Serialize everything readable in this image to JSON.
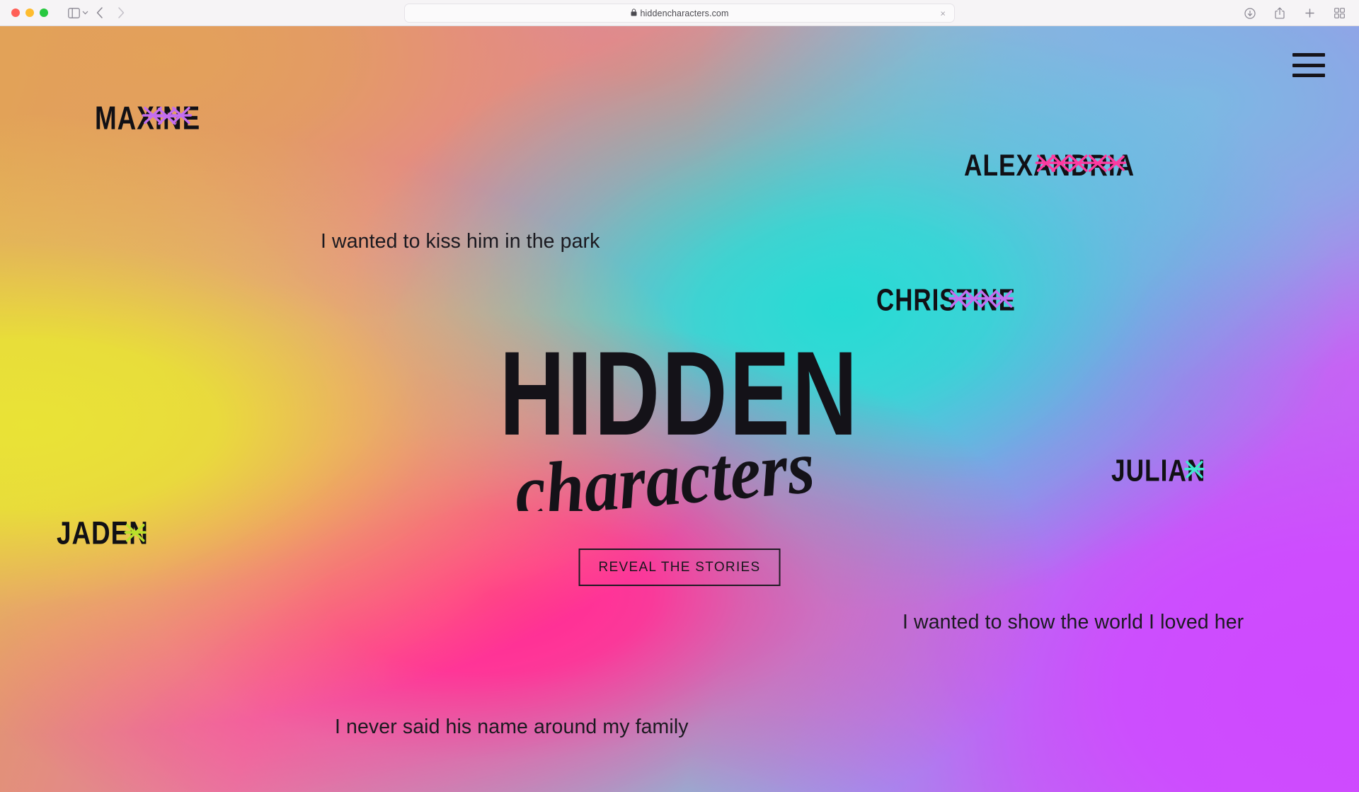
{
  "browser": {
    "url": "hiddencharacters.com",
    "secure_icon": "lock-icon",
    "clear_label": "×",
    "back_label": "‹",
    "forward_label": "›",
    "sidebar_label": "sidebar-icon",
    "tools": {
      "downloads": "downloads-icon",
      "share": "share-icon",
      "new_tab": "new-tab-icon",
      "tab_overview": "tab-overview-icon"
    }
  },
  "site": {
    "menu_label": "Menu",
    "logo": {
      "line1": "HIDDEN",
      "line2": "characters"
    },
    "cta": {
      "label": "REVEAL THE STORIES"
    },
    "names": [
      {
        "id": "maxine",
        "text": "MAXINE",
        "scribble_color": "#c46ef0",
        "scribble_count": 3
      },
      {
        "id": "alexandria",
        "text": "ALEXANDRIA",
        "scribble_color": "#ff3ba0",
        "scribble_count": 4
      },
      {
        "id": "christine",
        "text": "CHRISTINE",
        "scribble_color": "#c46ef0",
        "scribble_count": 4
      },
      {
        "id": "julian",
        "text": "JULIAN",
        "scribble_color": "#3fe8cf",
        "scribble_count": 1
      },
      {
        "id": "jaden",
        "text": "JADEN",
        "scribble_color": "#b8e02a",
        "scribble_count": 1
      }
    ],
    "quotes": [
      {
        "id": "park",
        "text": "I wanted to kiss him in the park"
      },
      {
        "id": "world",
        "text": "I wanted to show the world I loved her"
      },
      {
        "id": "family",
        "text": "I never said his name around my family"
      }
    ],
    "colors": {
      "ink": "#16141a",
      "gradient_yellow": "#e8e23f",
      "gradient_pink": "#ff2b8f",
      "gradient_teal": "#2fd9d2",
      "gradient_purple": "#c94bf7",
      "gradient_blue": "#7fb8e0",
      "gradient_orange": "#e0a25e"
    }
  }
}
